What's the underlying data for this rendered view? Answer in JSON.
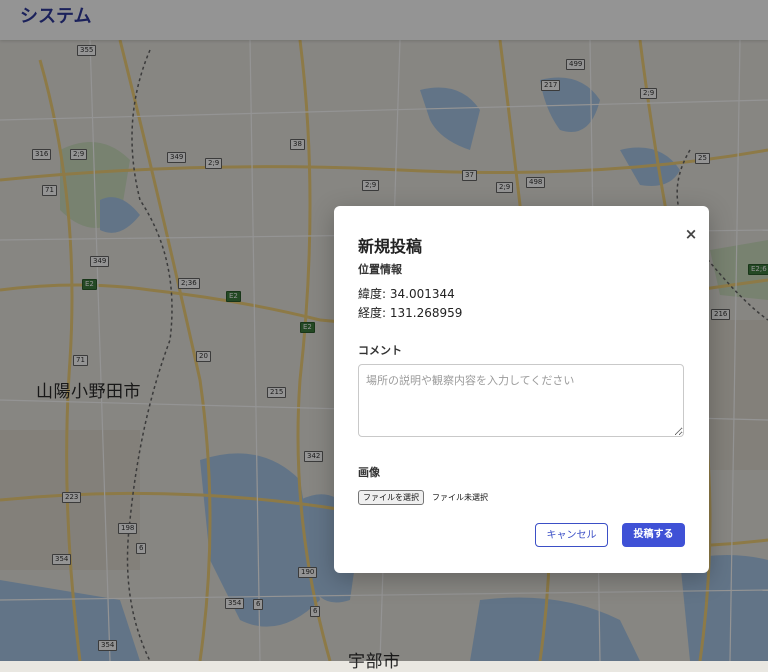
{
  "header": {
    "title": "システム"
  },
  "map": {
    "cities": [
      {
        "name": "山陽小野田市"
      },
      {
        "name": "宇部市"
      }
    ],
    "shields": [
      "355",
      "316",
      "2;9",
      "349",
      "2;9",
      "38",
      "499",
      "217",
      "2;9",
      "71",
      "2;9",
      "37",
      "2;9",
      "498",
      "25",
      "349",
      "E2",
      "2;36",
      "E2",
      "E2",
      "216",
      "E2;6",
      "71",
      "20",
      "215",
      "342",
      "223",
      "198",
      "354",
      "6",
      "190",
      "354",
      "6",
      "6",
      "354"
    ]
  },
  "modal": {
    "title": "新規投稿",
    "close_icon": "×",
    "location_label": "位置情報",
    "latitude": "緯度: 34.001344",
    "longitude": "経度: 131.268959",
    "comment_label": "コメント",
    "comment_placeholder": "場所の説明や観察内容を入力してください",
    "image_label": "画像",
    "file_button": "ファイルを選択",
    "file_status": "ファイル未選択",
    "cancel_label": "キャンセル",
    "submit_label": "投稿する"
  },
  "colors": {
    "accent": "#3f51d6",
    "header_title": "#2f3a9e",
    "overlay": "rgba(0,0,0,0.42)"
  }
}
